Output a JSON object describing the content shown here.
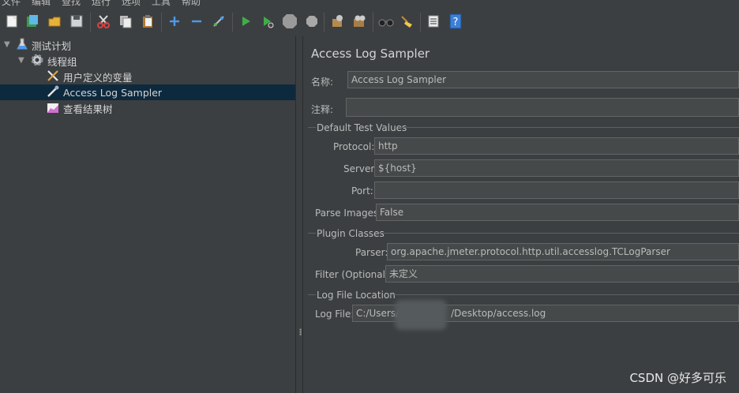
{
  "menu": [
    "文件",
    "编辑",
    "查找",
    "运行",
    "选项",
    "工具",
    "帮助"
  ],
  "toolbar": {
    "icons": [
      "new-icon",
      "templates-icon",
      "open-icon",
      "save-icon",
      "cut-icon",
      "copy-icon",
      "paste-icon",
      "expand-icon",
      "collapse-icon",
      "toggle-icon",
      "start-icon",
      "start-no-pause-icon",
      "stop-icon",
      "shutdown-icon",
      "clear-icon",
      "clear-all-icon",
      "search-icon",
      "reset-search-icon",
      "function-helper-icon",
      "help-icon"
    ]
  },
  "tree": {
    "nodes": [
      {
        "label": "测试计划",
        "icon": "test-plan-icon"
      },
      {
        "label": "线程组",
        "icon": "gear-icon"
      },
      {
        "label": "用户定义的变量",
        "icon": "wrench-icon"
      },
      {
        "label": "Access Log Sampler",
        "icon": "pipette-icon"
      },
      {
        "label": "查看结果树",
        "icon": "chart-icon"
      }
    ],
    "selected_index": 3
  },
  "panel": {
    "title": "Access Log Sampler",
    "name_label": "名称:",
    "name_value": "Access Log Sampler",
    "comment_label": "注释:",
    "comment_value": "",
    "default_test_values": {
      "title": "Default Test Values",
      "protocol_label": "Protocol:",
      "protocol_value": "http",
      "server_label": "Server:",
      "server_value": "${host}",
      "port_label": "Port:",
      "port_value": "",
      "parse_images_label": "Parse Images:",
      "parse_images_value": "False"
    },
    "plugin_classes": {
      "title": "Plugin Classes",
      "parser_label": "Parser:",
      "parser_value": "org.apache.jmeter.protocol.http.util.accesslog.TCLogParser",
      "filter_label": "Filter (Optional):",
      "filter_value": "未定义"
    },
    "log_file_location": {
      "title": "Log File Location",
      "log_file_label": "Log File:",
      "log_file_prefix": "C:/Users/",
      "log_file_suffix": "/Desktop/access.log"
    }
  },
  "watermark": "CSDN @好多可乐"
}
